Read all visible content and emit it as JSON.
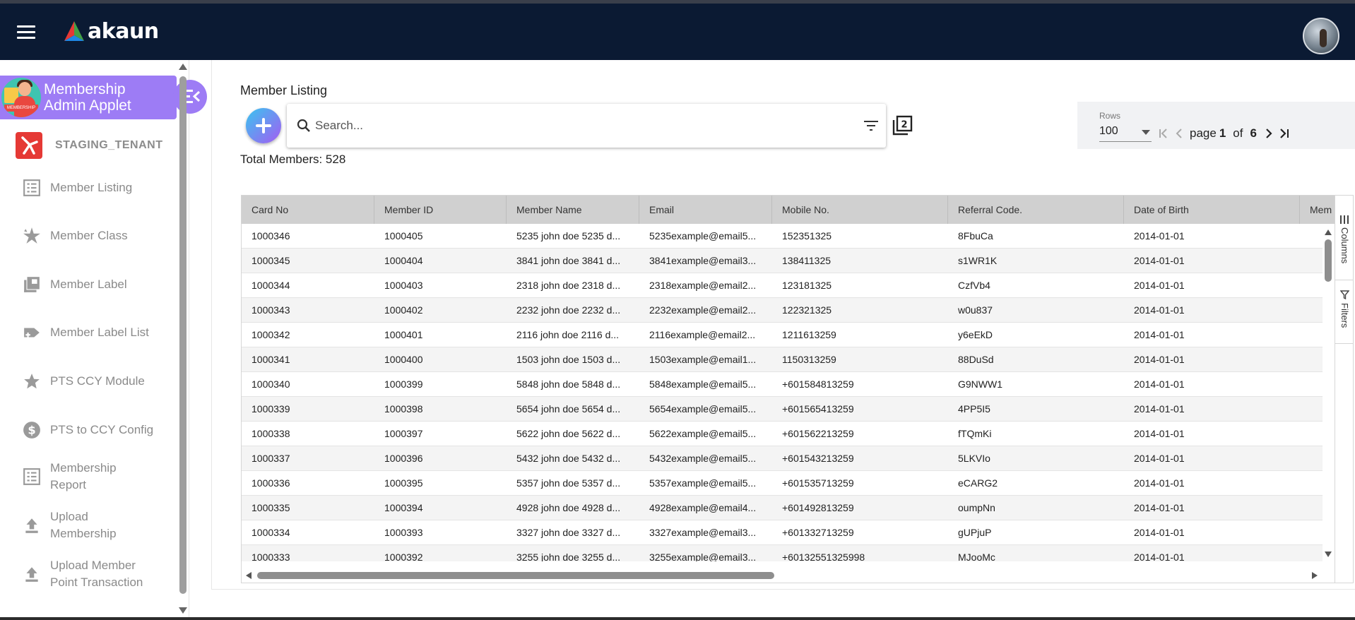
{
  "header": {
    "logo_text": "akaun",
    "brand_colors": [
      "#e53935",
      "#1e88e5",
      "#43a047"
    ],
    "bg_color": "#0b1a33"
  },
  "sidebar": {
    "applet_title_line1": "Membership",
    "applet_title_line2": "Admin Applet",
    "applet_badge": "MEMBERSHIP",
    "tenant": "STAGING_TENANT",
    "items": [
      {
        "label1": "Member Listing",
        "label2": "",
        "icon": "list-icon"
      },
      {
        "label1": "Member Class",
        "label2": "",
        "icon": "star-burst-icon"
      },
      {
        "label1": "Member Label",
        "label2": "",
        "icon": "library-icon"
      },
      {
        "label1": "Member Label List",
        "label2": "",
        "icon": "label-add-icon"
      },
      {
        "label1": "PTS CCY Module",
        "label2": "",
        "icon": "star-icon"
      },
      {
        "label1": "PTS to CCY Config",
        "label2": "",
        "icon": "dollar-icon"
      },
      {
        "label1": "Membership",
        "label2": "Report",
        "icon": "report-icon"
      },
      {
        "label1": "Upload",
        "label2": "Membership",
        "icon": "upload-icon"
      },
      {
        "label1": "Upload Member",
        "label2": "Point Transaction",
        "icon": "upload-icon"
      }
    ]
  },
  "main": {
    "title": "Member Listing",
    "search_placeholder": "Search...",
    "total_label": "Total Members: 528",
    "rows_label": "Rows",
    "rows_value": "100",
    "page_word": "page",
    "page_current": "1",
    "of_word": "of",
    "page_total": "6"
  },
  "table": {
    "columns": [
      "Card No",
      "Member ID",
      "Member Name",
      "Email",
      "Mobile No.",
      "Referral Code.",
      "Date of Birth",
      "Mem"
    ],
    "rows": [
      [
        "1000346",
        "1000405",
        "5235 john doe 5235 d...",
        "5235example@email5...",
        "152351325",
        "8FbuCa",
        "2014-01-01"
      ],
      [
        "1000345",
        "1000404",
        "3841 john doe 3841 d...",
        "3841example@email3...",
        "138411325",
        "s1WR1K",
        "2014-01-01"
      ],
      [
        "1000344",
        "1000403",
        "2318 john doe 2318 d...",
        "2318example@email2...",
        "123181325",
        "CzfVb4",
        "2014-01-01"
      ],
      [
        "1000343",
        "1000402",
        "2232 john doe 2232 d...",
        "2232example@email2...",
        "122321325",
        "w0u837",
        "2014-01-01"
      ],
      [
        "1000342",
        "1000401",
        "2116 john doe 2116 d...",
        "2116example@email2...",
        "1211613259",
        "y6eEkD",
        "2014-01-01"
      ],
      [
        "1000341",
        "1000400",
        "1503 john doe 1503 d...",
        "1503example@email1...",
        "1150313259",
        "88DuSd",
        "2014-01-01"
      ],
      [
        "1000340",
        "1000399",
        "5848 john doe 5848 d...",
        "5848example@email5...",
        "+601584813259",
        "G9NWW1",
        "2014-01-01"
      ],
      [
        "1000339",
        "1000398",
        "5654 john doe 5654 d...",
        "5654example@email5...",
        "+601565413259",
        "4PP5I5",
        "2014-01-01"
      ],
      [
        "1000338",
        "1000397",
        "5622 john doe 5622 d...",
        "5622example@email5...",
        "+601562213259",
        "fTQmKi",
        "2014-01-01"
      ],
      [
        "1000337",
        "1000396",
        "5432 john doe 5432 d...",
        "5432example@email5...",
        "+601543213259",
        "5LKVIo",
        "2014-01-01"
      ],
      [
        "1000336",
        "1000395",
        "5357 john doe 5357 d...",
        "5357example@email5...",
        "+601535713259",
        "eCARG2",
        "2014-01-01"
      ],
      [
        "1000335",
        "1000394",
        "4928 john doe 4928 d...",
        "4928example@email4...",
        "+601492813259",
        "oumpNn",
        "2014-01-01"
      ],
      [
        "1000334",
        "1000393",
        "3327 john doe 3327 d...",
        "3327example@email3...",
        "+601332713259",
        "gUPjuP",
        "2014-01-01"
      ],
      [
        "1000333",
        "1000392",
        "3255 john doe 3255 d...",
        "3255example@email3...",
        "+60132551325998",
        "MJooMc",
        "2014-01-01"
      ]
    ]
  },
  "side_panel": {
    "columns_label": "Columns",
    "filters_label": "Filters"
  },
  "colors": {
    "applet_purple": "#9d7cf5",
    "header_navy": "#0b1a33",
    "grid_header": "#d0d0d0"
  }
}
